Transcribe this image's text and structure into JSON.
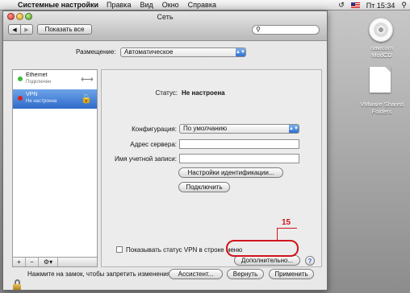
{
  "menubar": {
    "app": "Системные настройки",
    "menus": [
      "Правка",
      "Вид",
      "Окно",
      "Справка"
    ],
    "clock": "Пт 15:34"
  },
  "window": {
    "title": "Сеть",
    "show_all": "Показать все",
    "search_placeholder": "",
    "nav_back": "◀",
    "nav_forward": "▶"
  },
  "location": {
    "label": "Размещение:",
    "value": "Автоматическое"
  },
  "services": [
    {
      "name": "Ethernet",
      "status": "Подключен",
      "icon": "ethernet-arrows-icon",
      "status_color": "#3cbc3a"
    },
    {
      "name": "VPN",
      "status": "Не настроена",
      "icon": "vpn-lock-icon",
      "status_color": "#d8231b"
    }
  ],
  "service_controls": [
    "+",
    "−",
    "⚙▾"
  ],
  "detail": {
    "status_label": "Статус:",
    "status_value": "Не настроена",
    "config_label": "Конфигурация:",
    "config_value": "По умолчанию",
    "server_label": "Адрес сервера:",
    "server_value": "",
    "account_label": "Имя учетной записи:",
    "account_value": "",
    "auth_button": "Настройки идентификации...",
    "connect_button": "Подключить",
    "show_vpn_checkbox": "Показывать статус VPN в строке меню",
    "show_vpn_checked": false,
    "advanced_button": "Дополнительно...",
    "help": "?"
  },
  "annotation": {
    "number": "15",
    "color": "#d0141b"
  },
  "bottom": {
    "lock_text": "Нажмите на замок, чтобы запретить изменения.",
    "assistant": "Ассистент...",
    "revert": "Вернуть",
    "apply": "Применить"
  },
  "desktop_icons": [
    {
      "label_line1": "nawcom",
      "label_line2": "ModCD",
      "icon": "cd-disc-icon"
    },
    {
      "label_line1": "VMware Shared",
      "label_line2": "Folders",
      "icon": "document-icon"
    }
  ]
}
